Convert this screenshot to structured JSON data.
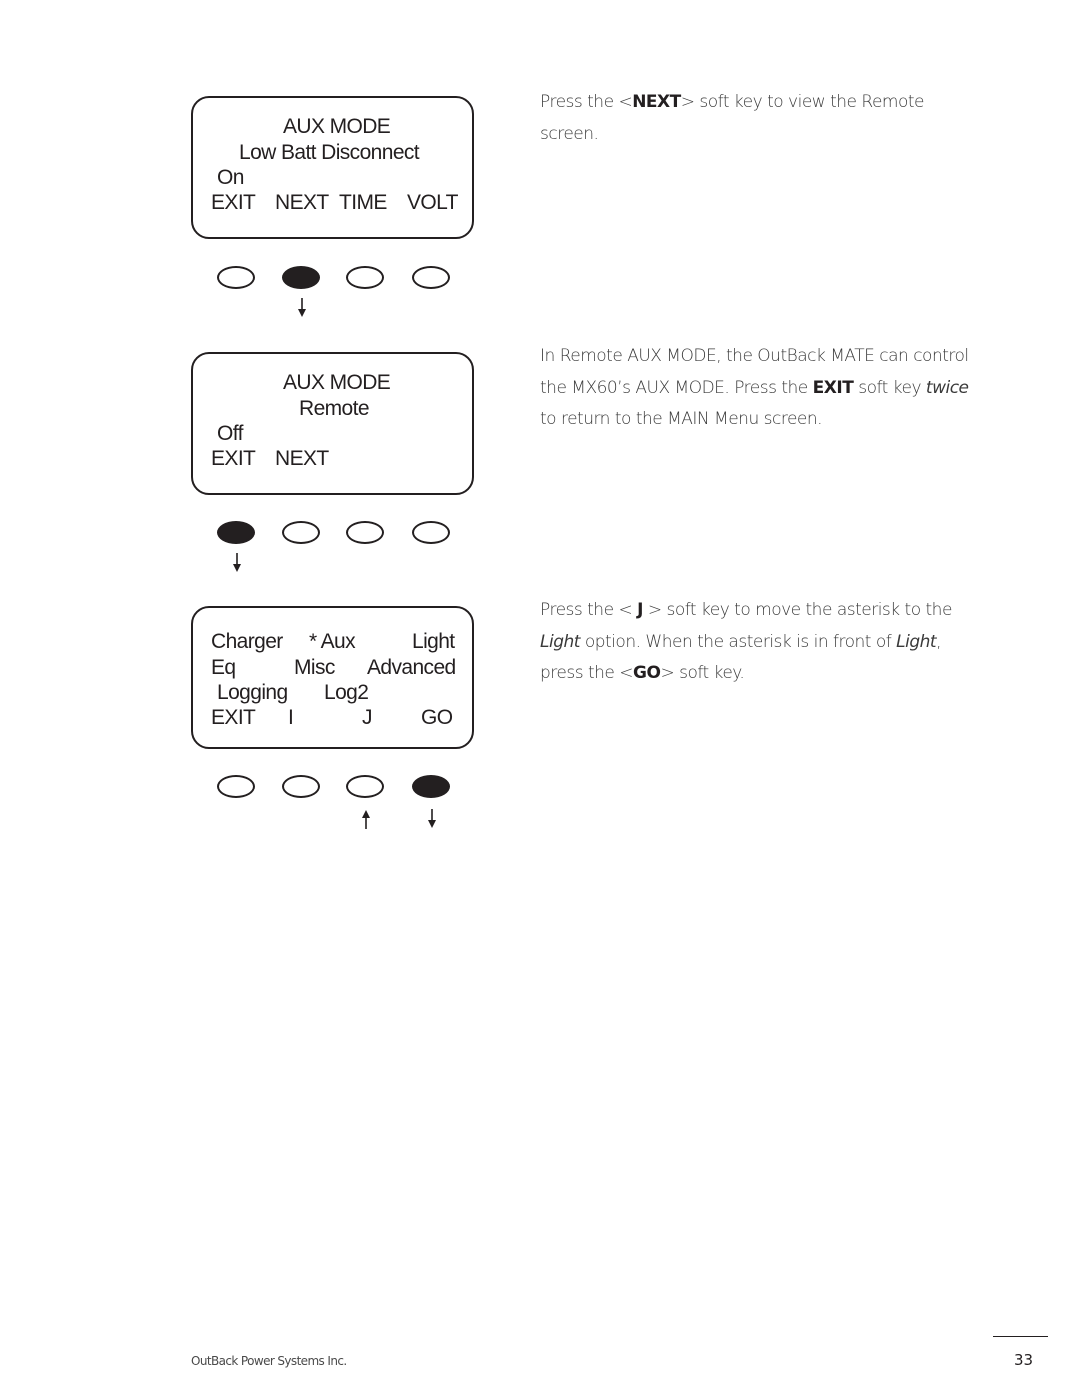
{
  "screens": [
    {
      "title": "AUX MODE",
      "subtitle": "Low Batt Disconnect",
      "status": "On",
      "softkeys": [
        "EXIT",
        "NEXT",
        "TIME",
        "VOLT"
      ],
      "pressed_key_index": 1,
      "arrows": [
        {
          "key_index": 1,
          "direction": "down"
        }
      ]
    },
    {
      "title": "AUX MODE",
      "subtitle": "Remote",
      "status": "Off",
      "softkeys": [
        "EXIT",
        "NEXT"
      ],
      "pressed_key_index": 0,
      "arrows": [
        {
          "key_index": 0,
          "direction": "down"
        }
      ]
    },
    {
      "menu_rows": [
        [
          "Charger",
          "* Aux",
          "Light"
        ],
        [
          "Eq",
          "Misc",
          "Advanced"
        ],
        [
          "Logging",
          "Log2"
        ]
      ],
      "softkeys": [
        "EXIT",
        "I",
        "J",
        "GO"
      ],
      "pressed_key_index": 3,
      "arrows": [
        {
          "key_index": 2,
          "direction": "up"
        },
        {
          "key_index": 3,
          "direction": "down"
        }
      ]
    }
  ],
  "instructions": [
    {
      "parts": [
        {
          "t": "Press the <"
        },
        {
          "t": "NEXT",
          "style": "bold"
        },
        {
          "t": "> soft key to view the Remote screen."
        }
      ]
    },
    {
      "parts": [
        {
          "t": "In Remote AUX MODE, the OutBack MATE can control the MX60’s AUX MODE. Press the "
        },
        {
          "t": "EXIT",
          "style": "bold"
        },
        {
          "t": " soft key "
        },
        {
          "t": "twice",
          "style": "italic"
        },
        {
          "t": " to return to the MAIN Menu screen."
        }
      ]
    },
    {
      "parts": [
        {
          "t": "Press the < "
        },
        {
          "t": "J",
          "style": "bold"
        },
        {
          "t": " > soft key to move the asterisk to the "
        },
        {
          "t": "Light",
          "style": "italic"
        },
        {
          "t": " option. When the asterisk is in front of "
        },
        {
          "t": "Light",
          "style": "italic"
        },
        {
          "t": ", press the <"
        },
        {
          "t": "GO",
          "style": "bold"
        },
        {
          "t": "> soft key."
        }
      ]
    }
  ],
  "footer": {
    "company": "OutBack Power Systems Inc.",
    "page_number": "33"
  }
}
